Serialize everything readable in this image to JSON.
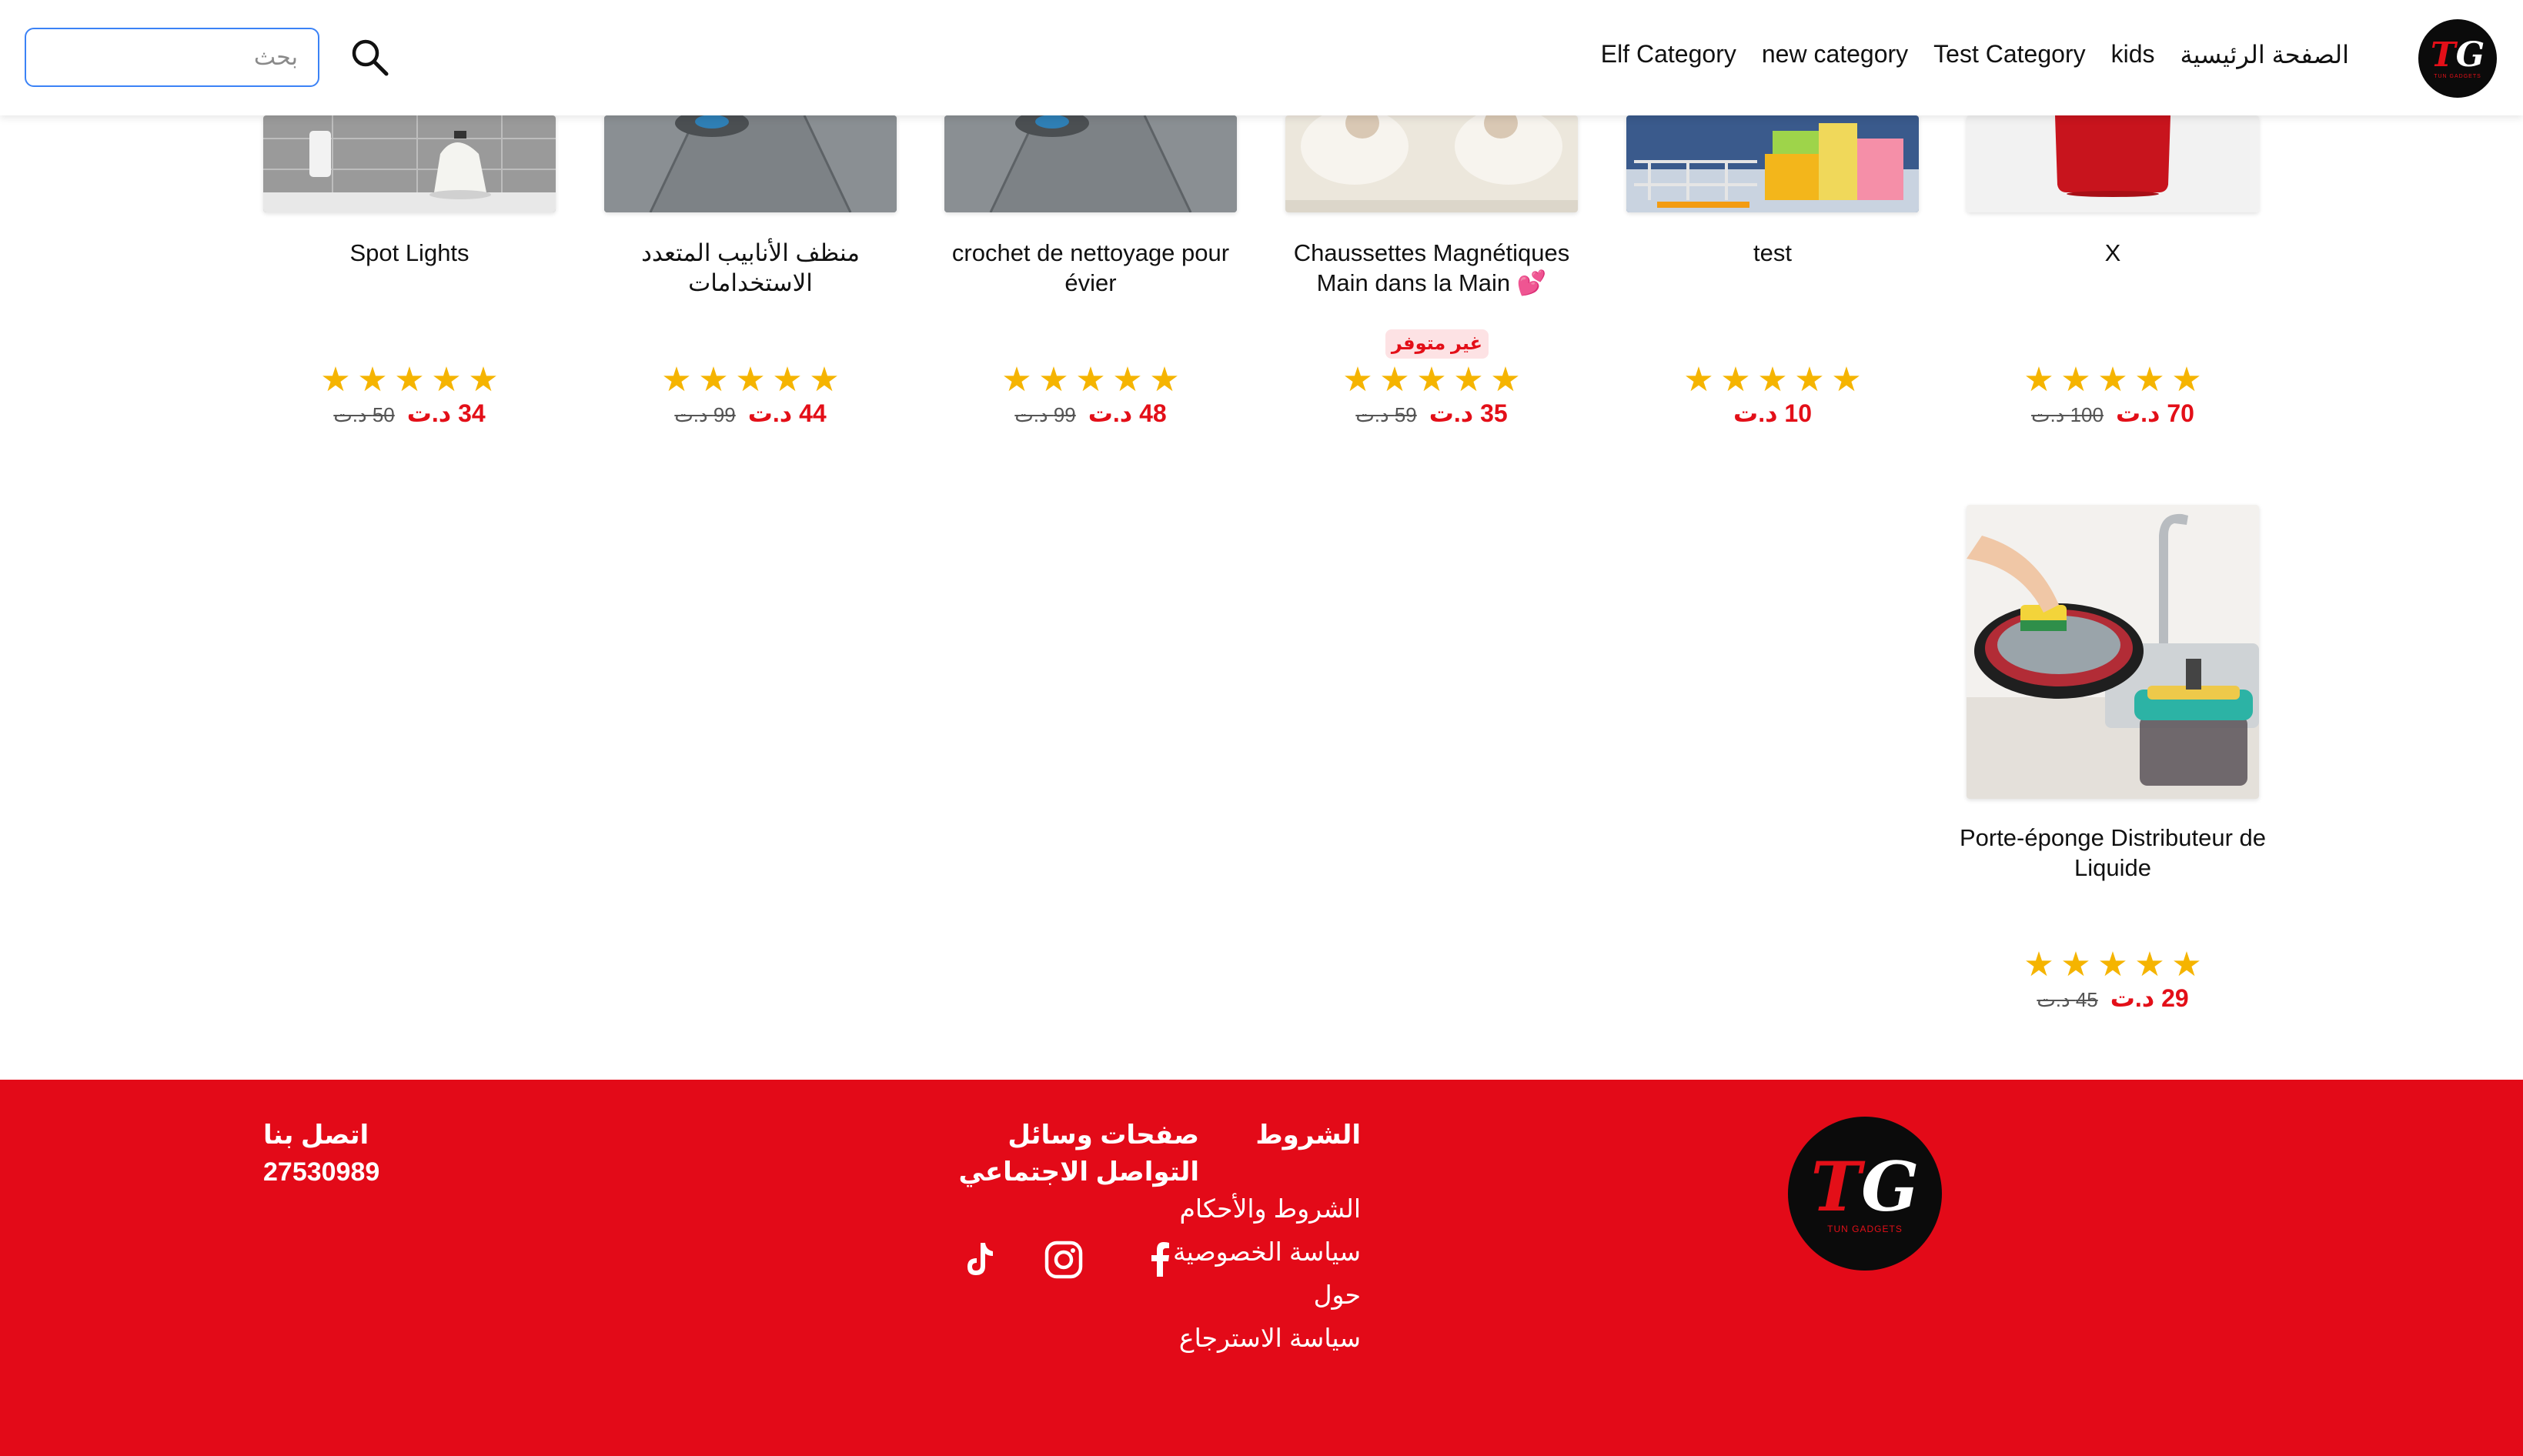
{
  "header": {
    "logo_text": "TG",
    "logo_sub": "TUN GADGETS",
    "nav": [
      "الصفحة الرئيسية",
      "kids",
      "Test Category",
      "new category",
      "Elf Category"
    ],
    "search": {
      "placeholder": "بحث",
      "value": ""
    },
    "icons": {
      "search": "search-icon"
    }
  },
  "products": [
    {
      "name": "Spot Lights",
      "price": "34 د.ت",
      "old_price": "50 د.ت",
      "rating": 5,
      "out_of_stock": false
    },
    {
      "name": "منظف الأنابيب المتعدد الاستخدامات",
      "price": "44 د.ت",
      "old_price": "99 د.ت",
      "rating": 5,
      "out_of_stock": false
    },
    {
      "name": "crochet de nettoyage pour évier",
      "price": "48 د.ت",
      "old_price": "99 د.ت",
      "rating": 5,
      "out_of_stock": false
    },
    {
      "name": "Chaussettes Magnétiques Main dans la Main 💕",
      "price": "35 د.ت",
      "old_price": "59 د.ت",
      "rating": 5,
      "out_of_stock": true,
      "badge": "غير متوفر"
    },
    {
      "name": "test",
      "price": "10 د.ت",
      "old_price": "",
      "rating": 5,
      "out_of_stock": false
    },
    {
      "name": "X",
      "price": "70 د.ت",
      "old_price": "100 د.ت",
      "rating": 5,
      "out_of_stock": false
    },
    {
      "name": "Porte-éponge Distributeur de Liquide",
      "price": "29 د.ت",
      "old_price": "45 د.ت",
      "rating": 5,
      "out_of_stock": false
    }
  ],
  "footer": {
    "logo_text": "TG",
    "logo_sub": "TUN GADGETS",
    "terms": {
      "title": "الشروط",
      "links": [
        "الشروط والأحكام",
        "سياسة الخصوصية",
        "حول",
        "سياسة الاسترجاع"
      ]
    },
    "social": {
      "title": "صفحات وسائل التواصل الاجتماعي",
      "icons": [
        "facebook-icon",
        "instagram-icon",
        "tiktok-icon"
      ]
    },
    "contact": {
      "title": "اتصل بنا",
      "phone": "27530989"
    }
  },
  "colors": {
    "brand_red": "#e30a18",
    "star": "#f5b400",
    "price_red": "#e30f18",
    "footer_bg": "#e30a18"
  }
}
